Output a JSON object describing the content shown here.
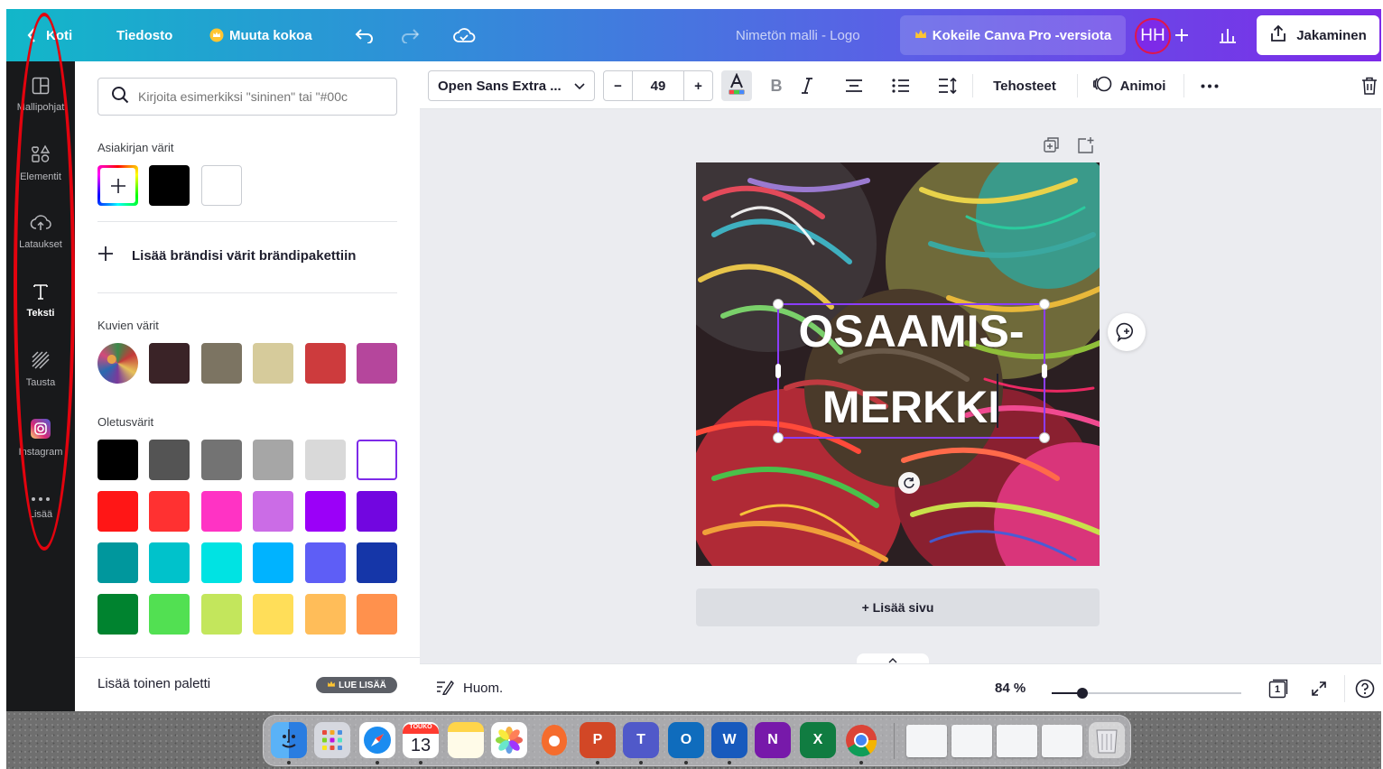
{
  "topbar": {
    "home_label": "Koti",
    "file_label": "Tiedosto",
    "resize_label": "Muuta kokoa",
    "title": "Nimetön malli - Logo",
    "pro_label": "Kokeile Canva Pro -versiota",
    "avatar_initials": "HH",
    "share_label": "Jakaminen"
  },
  "rail": {
    "items": [
      {
        "label": "Mallipohjat",
        "icon": "template-icon"
      },
      {
        "label": "Elementit",
        "icon": "elements-icon"
      },
      {
        "label": "Lataukset",
        "icon": "upload-icon"
      },
      {
        "label": "Teksti",
        "icon": "text-icon"
      },
      {
        "label": "Tausta",
        "icon": "background-icon"
      },
      {
        "label": "Instagram",
        "icon": "instagram-icon"
      },
      {
        "label": "Lisää",
        "icon": "more-icon"
      }
    ]
  },
  "panel": {
    "search_placeholder": "Kirjoita esimerkiksi \"sininen\" tai \"#00c",
    "document_colors_label": "Asiakirjan värit",
    "document_colors": [
      "#000000",
      "#ffffff"
    ],
    "add_brand_label": "Lisää brändisi värit brändipakettiin",
    "photo_colors_label": "Kuvien värit",
    "photo_colors": [
      "#3a2327",
      "#7c7462",
      "#d6cb9b",
      "#cd3b3d",
      "#b5469c"
    ],
    "default_colors_label": "Oletusvärit",
    "default_colors": [
      "#000000",
      "#545454",
      "#737373",
      "#a6a6a6",
      "#d9d9d9",
      "#ffffff",
      "#ff1616",
      "#ff3131",
      "#ff33c4",
      "#cb6ce6",
      "#9b00f8",
      "#7206e0",
      "#00979d",
      "#00c2cb",
      "#00e3e3",
      "#00b3ff",
      "#5e5ef6",
      "#1536a8",
      "#00832f",
      "#52e052",
      "#c3e65c",
      "#ffde59",
      "#ffbd59",
      "#ff914d"
    ],
    "another_palette_label": "Lisää toinen paletti",
    "read_more_label": "LUE LISÄÄ"
  },
  "toolbar": {
    "font_name": "Open Sans Extra ...",
    "font_size": "49",
    "effects_label": "Tehosteet",
    "animate_label": "Animoi"
  },
  "canvas": {
    "text_line1": "OSAAMIS-",
    "text_line2": "MERKKI",
    "add_page_label": "+ Lisää sivu"
  },
  "bottombar": {
    "notes_label": "Huom.",
    "zoom": "84 %",
    "zoom_fraction": 0.16,
    "page_count": "1"
  },
  "dock": {
    "calendar_month": "TOUKO",
    "calendar_day": "13"
  },
  "colors": {
    "accent_purple": "#7d2ae8",
    "selection": "#8b3dff",
    "annotation_red": "#e3030e"
  }
}
